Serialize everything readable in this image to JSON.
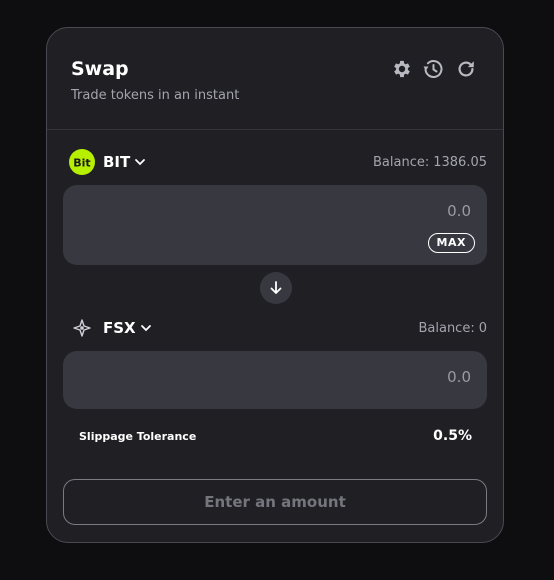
{
  "header": {
    "title": "Swap",
    "subtitle": "Trade tokens in an instant",
    "icons": [
      "settings-icon",
      "history-icon",
      "refresh-icon"
    ]
  },
  "from": {
    "token": "BIT",
    "logo_text": "Bit",
    "logo_color": "#b6f000",
    "balance_label": "Balance:",
    "balance_value": "1386.05",
    "amount_placeholder": "0.0",
    "max_label": "MAX"
  },
  "to": {
    "token": "FSX",
    "balance_label": "Balance:",
    "balance_value": "0",
    "amount_placeholder": "0.0"
  },
  "slippage": {
    "label": "Slippage Tolerance",
    "value": "0.5%"
  },
  "action_button": {
    "label": "Enter an amount"
  },
  "colors": {
    "background": "#0e0e10",
    "card": "#1f1f24",
    "input_box": "#383841",
    "muted_text": "#a4a4ad"
  }
}
